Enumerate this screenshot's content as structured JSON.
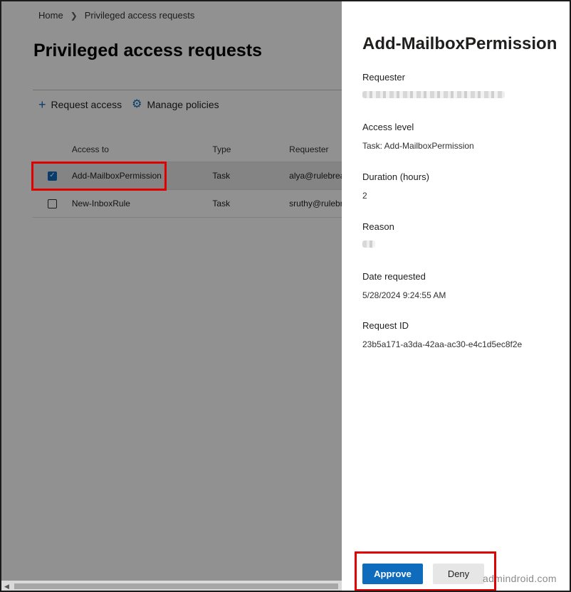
{
  "breadcrumb": {
    "home": "Home",
    "current": "Privileged access requests"
  },
  "page": {
    "title": "Privileged access requests"
  },
  "toolbar": {
    "request_access": {
      "label": "Request access",
      "icon": "plus-icon"
    },
    "manage_policies": {
      "label": "Manage policies",
      "icon": "gear-icon"
    }
  },
  "table": {
    "columns": [
      "Access to",
      "Type",
      "Requester"
    ],
    "rows": [
      {
        "access": "Add-MailboxPermission",
        "type": "Task",
        "requester": "alya@rulebreak",
        "selected": true
      },
      {
        "access": "New-InboxRule",
        "type": "Task",
        "requester": "sruthy@rulebre",
        "selected": false
      }
    ]
  },
  "panel": {
    "title": "Add-MailboxPermission",
    "fields": {
      "requester": {
        "label": "Requester"
      },
      "access_level": {
        "label": "Access level",
        "value": "Task: Add-MailboxPermission"
      },
      "duration": {
        "label": "Duration (hours)",
        "value": "2"
      },
      "reason": {
        "label": "Reason"
      },
      "date_requested": {
        "label": "Date requested",
        "value": "5/28/2024 9:24:55 AM"
      },
      "request_id": {
        "label": "Request ID",
        "value": "23b5a171-a3da-42aa-ac30-e4c1d5ec8f2e"
      }
    },
    "approve_label": "Approve",
    "deny_label": "Deny"
  },
  "watermark": "admindroid.com",
  "colors": {
    "accent": "#0f6cbd",
    "highlight": "#e00000"
  }
}
